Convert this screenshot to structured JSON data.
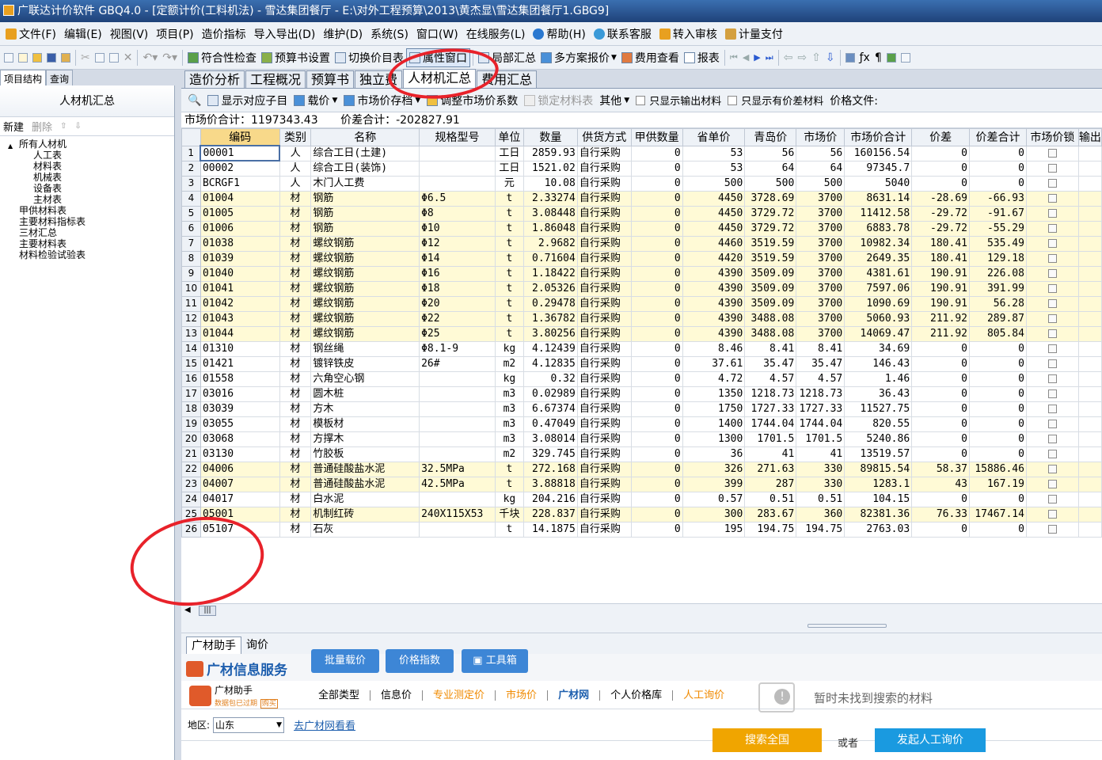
{
  "window": {
    "title": "广联达计价软件 GBQ4.0 - [定额计价(工料机法) - 雪达集团餐厅 - E:\\对外工程预算\\2013\\黄杰显\\雪达集团餐厅1.GBG9]"
  },
  "menu": [
    "文件(F)",
    "编辑(E)",
    "视图(V)",
    "项目(P)",
    "造价指标",
    "导入导出(D)",
    "维护(D)",
    "系统(S)",
    "窗口(W)",
    "在线服务(L)",
    "帮助(H)",
    "联系客服",
    "转入审核",
    "计量支付"
  ],
  "toolbar": {
    "labels": [
      "符合性检查",
      "预算书设置",
      "切换价目表",
      "属性窗口",
      "局部汇总",
      "多方案报价",
      "费用查看",
      "报表"
    ]
  },
  "left": {
    "tabs": [
      "项目结构",
      "查询"
    ],
    "title": "人材机汇总",
    "new_label": "新建",
    "delete_label": "删除",
    "tree": {
      "root": "所有人材机",
      "children": [
        "人工表",
        "材料表",
        "机械表",
        "设备表",
        "主材表"
      ],
      "others": [
        "甲供材料表",
        "主要材料指标表",
        "三材汇总",
        "主要材料表",
        "材料检验试验表"
      ]
    }
  },
  "doctabs": [
    "造价分析",
    "工程概况",
    "预算书",
    "独立费",
    "人材机汇总",
    "费用汇总"
  ],
  "subtoolbar": [
    "显示对应子目",
    "载价",
    "市场价存档",
    "调整市场价系数",
    "锁定材料表",
    "其他",
    "只显示输出材料",
    "只显示有价差材料",
    "价格文件:"
  ],
  "summary": {
    "market_total": "市场价合计：1197343.43",
    "diff_total": "价差合计：-202827.91"
  },
  "grid": {
    "headers": [
      "编码",
      "类别",
      "名称",
      "规格型号",
      "单位",
      "数量",
      "供货方式",
      "甲供数量",
      "省单价",
      "青岛价",
      "市场价",
      "市场价合计",
      "价差",
      "价差合计",
      "市场价锁",
      "输出"
    ],
    "rows": [
      [
        "1",
        "00001",
        "人",
        "综合工日(土建)",
        "",
        "工日",
        "2859.93",
        "自行采购",
        "0",
        "53",
        "56",
        "56",
        "160156.54",
        "0",
        "0"
      ],
      [
        "2",
        "00002",
        "人",
        "综合工日(装饰)",
        "",
        "工日",
        "1521.02",
        "自行采购",
        "0",
        "53",
        "64",
        "64",
        "97345.7",
        "0",
        "0"
      ],
      [
        "3",
        "BCRGF1",
        "人",
        "木门人工费",
        "",
        "元",
        "10.08",
        "自行采购",
        "0",
        "500",
        "500",
        "500",
        "5040",
        "0",
        "0"
      ],
      [
        "4",
        "01004",
        "材",
        "钢筋",
        "Φ6.5",
        "t",
        "2.33274",
        "自行采购",
        "0",
        "4450",
        "3728.69",
        "3700",
        "8631.14",
        "-28.69",
        "-66.93"
      ],
      [
        "5",
        "01005",
        "材",
        "钢筋",
        "Φ8",
        "t",
        "3.08448",
        "自行采购",
        "0",
        "4450",
        "3729.72",
        "3700",
        "11412.58",
        "-29.72",
        "-91.67"
      ],
      [
        "6",
        "01006",
        "材",
        "钢筋",
        "Φ10",
        "t",
        "1.86048",
        "自行采购",
        "0",
        "4450",
        "3729.72",
        "3700",
        "6883.78",
        "-29.72",
        "-55.29"
      ],
      [
        "7",
        "01038",
        "材",
        "螺纹钢筋",
        "Φ12",
        "t",
        "2.9682",
        "自行采购",
        "0",
        "4460",
        "3519.59",
        "3700",
        "10982.34",
        "180.41",
        "535.49"
      ],
      [
        "8",
        "01039",
        "材",
        "螺纹钢筋",
        "Φ14",
        "t",
        "0.71604",
        "自行采购",
        "0",
        "4420",
        "3519.59",
        "3700",
        "2649.35",
        "180.41",
        "129.18"
      ],
      [
        "9",
        "01040",
        "材",
        "螺纹钢筋",
        "Φ16",
        "t",
        "1.18422",
        "自行采购",
        "0",
        "4390",
        "3509.09",
        "3700",
        "4381.61",
        "190.91",
        "226.08"
      ],
      [
        "10",
        "01041",
        "材",
        "螺纹钢筋",
        "Φ18",
        "t",
        "2.05326",
        "自行采购",
        "0",
        "4390",
        "3509.09",
        "3700",
        "7597.06",
        "190.91",
        "391.99"
      ],
      [
        "11",
        "01042",
        "材",
        "螺纹钢筋",
        "Φ20",
        "t",
        "0.29478",
        "自行采购",
        "0",
        "4390",
        "3509.09",
        "3700",
        "1090.69",
        "190.91",
        "56.28"
      ],
      [
        "12",
        "01043",
        "材",
        "螺纹钢筋",
        "Φ22",
        "t",
        "1.36782",
        "自行采购",
        "0",
        "4390",
        "3488.08",
        "3700",
        "5060.93",
        "211.92",
        "289.87"
      ],
      [
        "13",
        "01044",
        "材",
        "螺纹钢筋",
        "Φ25",
        "t",
        "3.80256",
        "自行采购",
        "0",
        "4390",
        "3488.08",
        "3700",
        "14069.47",
        "211.92",
        "805.84"
      ],
      [
        "14",
        "01310",
        "材",
        "钢丝绳",
        "Φ8.1-9",
        "kg",
        "4.12439",
        "自行采购",
        "0",
        "8.46",
        "8.41",
        "8.41",
        "34.69",
        "0",
        "0"
      ],
      [
        "15",
        "01421",
        "材",
        "镀锌铁皮",
        "26#",
        "m2",
        "4.12835",
        "自行采购",
        "0",
        "37.61",
        "35.47",
        "35.47",
        "146.43",
        "0",
        "0"
      ],
      [
        "16",
        "01558",
        "材",
        "六角空心钢",
        "",
        "kg",
        "0.32",
        "自行采购",
        "0",
        "4.72",
        "4.57",
        "4.57",
        "1.46",
        "0",
        "0"
      ],
      [
        "17",
        "03016",
        "材",
        "圆木桩",
        "",
        "m3",
        "0.02989",
        "自行采购",
        "0",
        "1350",
        "1218.73",
        "1218.73",
        "36.43",
        "0",
        "0"
      ],
      [
        "18",
        "03039",
        "材",
        "方木",
        "",
        "m3",
        "6.67374",
        "自行采购",
        "0",
        "1750",
        "1727.33",
        "1727.33",
        "11527.75",
        "0",
        "0"
      ],
      [
        "19",
        "03055",
        "材",
        "模板材",
        "",
        "m3",
        "0.47049",
        "自行采购",
        "0",
        "1400",
        "1744.04",
        "1744.04",
        "820.55",
        "0",
        "0"
      ],
      [
        "20",
        "03068",
        "材",
        "方撑木",
        "",
        "m3",
        "3.08014",
        "自行采购",
        "0",
        "1300",
        "1701.5",
        "1701.5",
        "5240.86",
        "0",
        "0"
      ],
      [
        "21",
        "03130",
        "材",
        "竹胶板",
        "",
        "m2",
        "329.745",
        "自行采购",
        "0",
        "36",
        "41",
        "41",
        "13519.57",
        "0",
        "0"
      ],
      [
        "22",
        "04006",
        "材",
        "普通硅酸盐水泥",
        "32.5MPa",
        "t",
        "272.168",
        "自行采购",
        "0",
        "326",
        "271.63",
        "330",
        "89815.54",
        "58.37",
        "15886.46"
      ],
      [
        "23",
        "04007",
        "材",
        "普通硅酸盐水泥",
        "42.5MPa",
        "t",
        "3.88818",
        "自行采购",
        "0",
        "399",
        "287",
        "330",
        "1283.1",
        "43",
        "167.19"
      ],
      [
        "24",
        "04017",
        "材",
        "白水泥",
        "",
        "kg",
        "204.216",
        "自行采购",
        "0",
        "0.57",
        "0.51",
        "0.51",
        "104.15",
        "0",
        "0"
      ],
      [
        "25",
        "05001",
        "材",
        "机制红砖",
        "240X115X53",
        "千块",
        "228.837",
        "自行采购",
        "0",
        "300",
        "283.67",
        "360",
        "82381.36",
        "76.33",
        "17467.14"
      ],
      [
        "26",
        "05107",
        "材",
        "石灰",
        "",
        "t",
        "14.1875",
        "自行采购",
        "0",
        "195",
        "194.75",
        "194.75",
        "2763.03",
        "0",
        "0"
      ]
    ]
  },
  "bottom": {
    "tabs": [
      "广材助手",
      "询价"
    ],
    "service_title": "广材信息服务",
    "buttons": [
      "批量载价",
      "价格指数",
      "工具箱"
    ],
    "brand": "广材助手",
    "brand_sub": "数据包已过期",
    "brand_buy": "购买",
    "nav": [
      "全部类型",
      "信息价",
      "专业测定价",
      "市场价",
      "广材网",
      "个人价格库",
      "人工询价"
    ],
    "region_label": "地区:",
    "region_value": "山东",
    "region_link": "去广材网看看",
    "empty_text": "暂时未找到搜索的材料",
    "search_all": "搜索全国",
    "or_text": "或者",
    "inquiry": "发起人工询价"
  },
  "colors": {
    "highlight_row": "#fffad6",
    "accent": "#3d86d6",
    "orange_btn": "#f0a500",
    "blue_btn": "#1a9ae0",
    "annotation": "#e8222a"
  }
}
